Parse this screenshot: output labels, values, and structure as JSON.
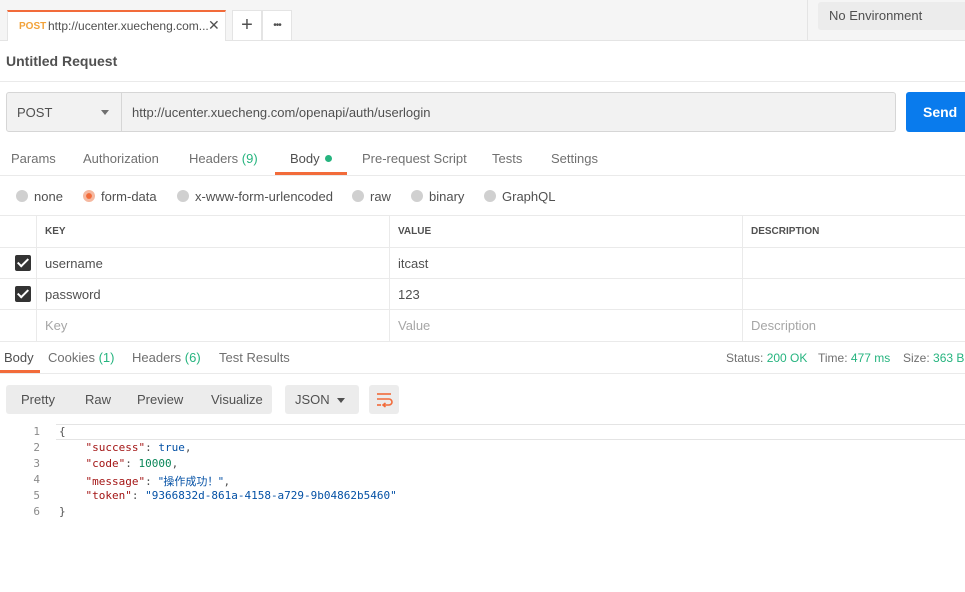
{
  "tab": {
    "method": "POST",
    "url": "http://ucenter.xuecheng.com...",
    "close": "✕"
  },
  "tab_actions": {
    "add": "+",
    "more": "•••"
  },
  "environment": "No Environment",
  "request_title": "Untitled Request",
  "method_select": "POST",
  "url": "http://ucenter.xuecheng.com/openapi/auth/userlogin",
  "send_label": "Send",
  "request_tabs": {
    "params": "Params",
    "authorization": "Authorization",
    "headers": "Headers",
    "headers_count": "(9)",
    "body": "Body",
    "prerequest": "Pre-request Script",
    "tests": "Tests",
    "settings": "Settings"
  },
  "body_types": [
    "none",
    "form-data",
    "x-www-form-urlencoded",
    "raw",
    "binary",
    "GraphQL"
  ],
  "body_type_selected": "form-data",
  "table": {
    "headers": {
      "key": "KEY",
      "value": "VALUE",
      "description": "DESCRIPTION"
    },
    "rows": [
      {
        "key": "username",
        "value": "itcast",
        "description": "",
        "checked": true
      },
      {
        "key": "password",
        "value": "123",
        "description": "",
        "checked": true
      }
    ],
    "placeholders": {
      "key": "Key",
      "value": "Value",
      "description": "Description"
    }
  },
  "response_tabs": {
    "body": "Body",
    "cookies": "Cookies",
    "cookies_count": "(1)",
    "headers": "Headers",
    "headers_count": "(6)",
    "test_results": "Test Results"
  },
  "status": {
    "status_label": "Status:",
    "status_value": "200 OK",
    "time_label": "Time:",
    "time_value": "477 ms",
    "size_label": "Size:",
    "size_value": "363 B"
  },
  "view_modes": [
    "Pretty",
    "Raw",
    "Preview",
    "Visualize"
  ],
  "format": "JSON",
  "code_lines": {
    "l1": "{",
    "l2_key": "\"success\"",
    "l2_val": "true",
    "l3_key": "\"code\"",
    "l3_val": "10000",
    "l4_key": "\"message\"",
    "l4_val": "\"操作成功！\"",
    "l5_key": "\"token\"",
    "l5_val": "\"9366832d-861a-4158-a729-9b04862b5460\"",
    "l6": "}"
  },
  "line_numbers": [
    "1",
    "2",
    "3",
    "4",
    "5",
    "6"
  ],
  "colors": {
    "accent": "#f26b3a",
    "send": "#097bed",
    "success": "#26b47f"
  }
}
